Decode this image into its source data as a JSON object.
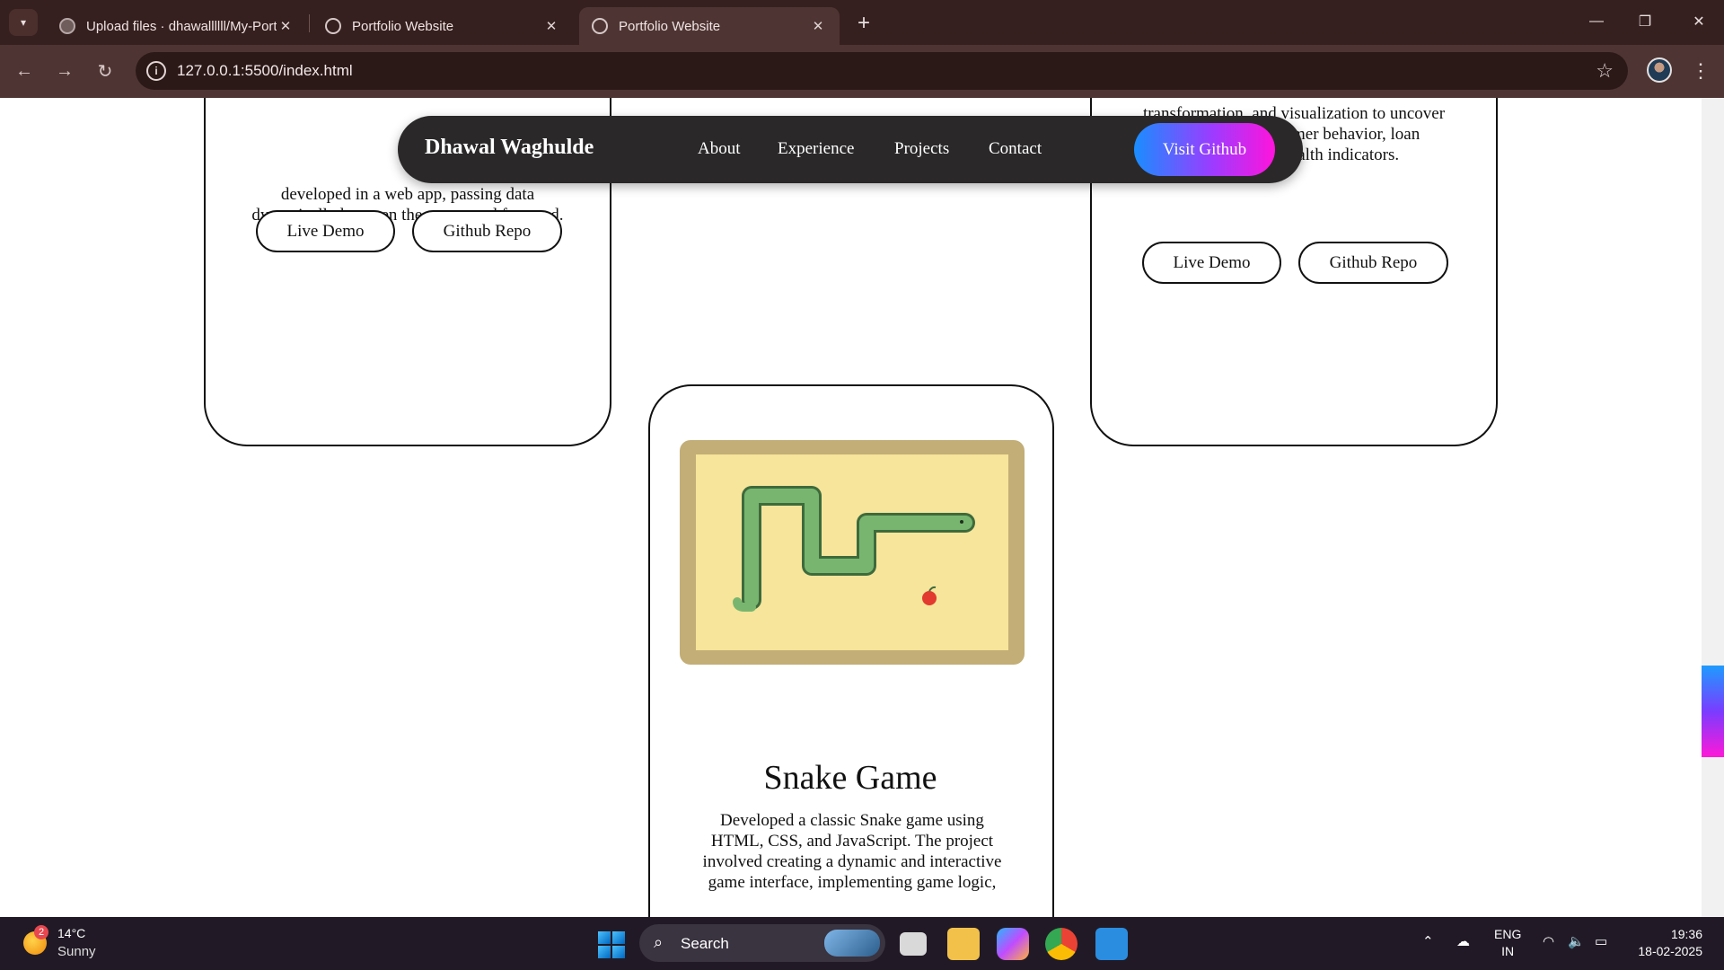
{
  "browser": {
    "tabs": [
      {
        "title": "Upload files · dhawallllll/My-Portfolio",
        "active": false
      },
      {
        "title": "Portfolio Website",
        "active": false
      },
      {
        "title": "Portfolio Website",
        "active": true
      }
    ],
    "url": "127.0.0.1:5500/index.html"
  },
  "navbar": {
    "brand": "Dhawal Waghulde",
    "links": [
      "About",
      "Experience",
      "Projects",
      "Contact"
    ],
    "cta": "Visit Github"
  },
  "cards": {
    "left": {
      "text_line1": "developed in a web app, passing data",
      "text_line2": "dynamically between the server and frontend.",
      "live_demo": "Live Demo",
      "github_repo": "Github Repo"
    },
    "right": {
      "text_line1": "transformation, and visualization to uncover",
      "text_line2": "insights into customer behavior, loan",
      "text_line3": "and financial health indicators.",
      "live_demo": "Live Demo",
      "github_repo": "Github Repo"
    },
    "snake": {
      "title": "Snake Game",
      "desc_line1": "Developed a classic Snake game using",
      "desc_line2": "HTML, CSS, and JavaScript. The project",
      "desc_line3": "involved creating a dynamic and interactive",
      "desc_line4": "game interface, implementing game logic,"
    }
  },
  "taskbar": {
    "weather_temp": "14°C",
    "weather_desc": "Sunny",
    "weather_badge": "2",
    "search_label": "Search",
    "lang_line1": "ENG",
    "lang_line2": "IN",
    "time": "19:36",
    "date": "18-02-2025"
  },
  "colors": {
    "chrome_bg": "#35201f",
    "toolbar_bg": "#4e3533",
    "navbar_bg": "#2a2828",
    "cta_gradient_start": "#1a8dff",
    "cta_gradient_end": "#ff14dc",
    "taskbar_bg": "#211a26"
  }
}
